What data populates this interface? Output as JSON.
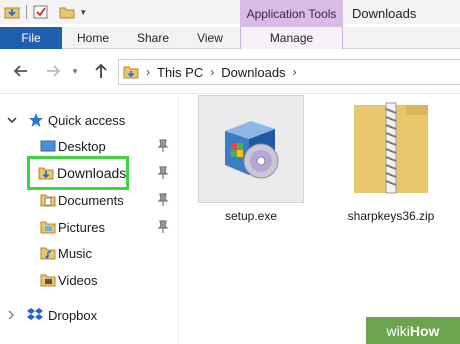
{
  "window": {
    "title": "Downloads"
  },
  "ribbon": {
    "context_header": "Application Tools",
    "tabs": [
      {
        "label": "File",
        "active": true
      },
      {
        "label": "Home"
      },
      {
        "label": "Share"
      },
      {
        "label": "View"
      },
      {
        "label": "Manage",
        "contextual": true
      }
    ]
  },
  "address_bar": {
    "breadcrumbs": [
      "This PC",
      "Downloads"
    ]
  },
  "navigation_pane": {
    "items": [
      {
        "label": "Quick access",
        "icon": "star-icon",
        "expandable": "expanded"
      },
      {
        "label": "Desktop",
        "icon": "desktop-folder-icon",
        "pinned": true
      },
      {
        "label": "Downloads",
        "icon": "downloads-folder-icon",
        "pinned": true,
        "highlighted": true
      },
      {
        "label": "Documents",
        "icon": "documents-folder-icon",
        "pinned": true
      },
      {
        "label": "Pictures",
        "icon": "pictures-folder-icon",
        "pinned": true
      },
      {
        "label": "Music",
        "icon": "music-folder-icon"
      },
      {
        "label": "Videos",
        "icon": "videos-folder-icon"
      },
      {
        "label": "Dropbox",
        "icon": "dropbox-icon",
        "expandable": "collapsed"
      }
    ]
  },
  "files": [
    {
      "name": "setup.exe",
      "icon": "installer-icon",
      "selected": true
    },
    {
      "name": "sharpkeys36.zip",
      "icon": "zip-folder-icon"
    }
  ],
  "watermark": {
    "prefix": "wiki",
    "suffix": "How"
  },
  "colors": {
    "file_tab": "#1f5fb0",
    "context_tab": "#d7bde3",
    "highlight": "#3ed63e",
    "folder": "#e7c66c"
  }
}
